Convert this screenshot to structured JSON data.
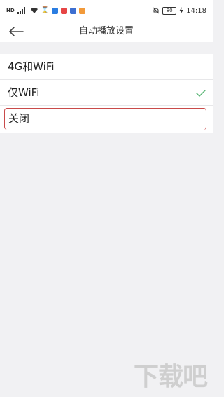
{
  "status_bar": {
    "time": "14:18",
    "battery": "80",
    "icons": [
      "hd-icon",
      "signal-4g-icon",
      "wifi-icon",
      "hourglass-icon",
      "app-icon-blue",
      "app-icon-red",
      "app-icon-blue2",
      "app-icon-orange",
      "alarm-mute-icon",
      "battery-icon",
      "charging-icon"
    ]
  },
  "header": {
    "title": "自动播放设置",
    "back_icon": "arrow-left-icon"
  },
  "options": [
    {
      "label": "4G和WiFi",
      "selected": false
    },
    {
      "label": "仅WiFi",
      "selected": true
    },
    {
      "label": "关闭",
      "selected": false,
      "highlighted": true
    }
  ],
  "colors": {
    "check": "#5fb87a",
    "highlight_border": "#c94a4a",
    "background": "#f1f1f3"
  },
  "watermark": {
    "text": "下载吧"
  }
}
